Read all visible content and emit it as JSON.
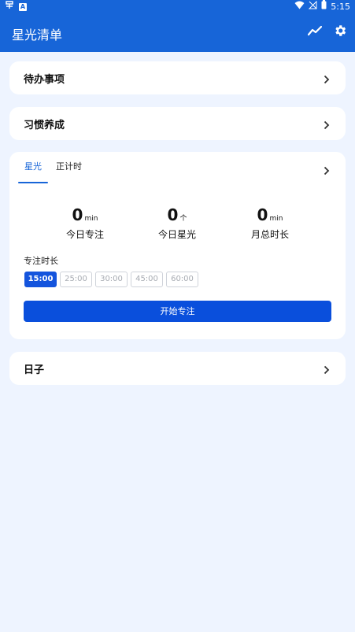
{
  "statusbar": {
    "time": "5:15"
  },
  "app": {
    "title": "星光清单"
  },
  "cards": {
    "todo": "待办事项",
    "habit": "习惯养成",
    "days": "日子"
  },
  "focus": {
    "tabs": [
      "星光",
      "正计时"
    ],
    "stats": [
      {
        "value": "0",
        "unit": "min",
        "caption": "今日专注"
      },
      {
        "value": "0",
        "unit": "个",
        "caption": "今日星光"
      },
      {
        "value": "0",
        "unit": "min",
        "caption": "月总时长"
      }
    ],
    "duration_label": "专注时长",
    "durations": [
      "15:00",
      "25:00",
      "30:00",
      "45:00",
      "60:00"
    ],
    "selected_duration": "15:00",
    "start_label": "开始专注"
  },
  "colors": {
    "primary": "#1765d8",
    "button": "#0a4fdc",
    "background": "#eef4ff"
  }
}
